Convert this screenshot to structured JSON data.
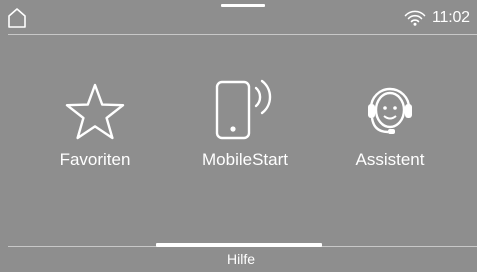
{
  "status_bar": {
    "time": "11:02",
    "icons": [
      "home-icon",
      "wifi-icon"
    ]
  },
  "tiles": [
    {
      "label": "Favoriten",
      "icon": "star-icon"
    },
    {
      "label": "MobileStart",
      "icon": "mobile-signal-icon"
    },
    {
      "label": "Assistent",
      "icon": "headset-assistant-icon"
    }
  ],
  "footer": {
    "help_label": "Hilfe"
  },
  "colors": {
    "background": "#8e8e8e",
    "foreground": "#ffffff",
    "divider": "#c8c8c8"
  }
}
